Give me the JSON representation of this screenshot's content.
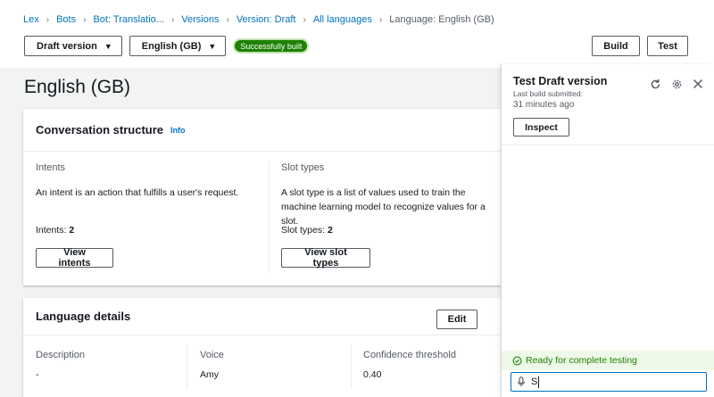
{
  "breadcrumb": {
    "items": [
      "Lex",
      "Bots",
      "Bot: Translatio...",
      "Versions",
      "Version: Draft",
      "All languages"
    ],
    "current": "Language: English (GB)"
  },
  "toolbar": {
    "version_dropdown": "Draft version",
    "language_dropdown": "English (GB)",
    "status_badge": "Successfully built",
    "build_label": "Build",
    "test_label": "Test"
  },
  "page_title": "English (GB)",
  "conversation": {
    "title": "Conversation structure",
    "info": "Info",
    "intents": {
      "label": "Intents",
      "description": "An intent is an action that fulfills a user's request.",
      "count_label": "Intents:",
      "count": "2",
      "button": "View intents"
    },
    "slot_types": {
      "label": "Slot types",
      "description": "A slot type is a list of values used to train the machine learning model to recognize values for a slot.",
      "count_label": "Slot types:",
      "count": "2",
      "button": "View slot types"
    }
  },
  "language_details": {
    "title": "Language details",
    "edit_label": "Edit",
    "description": {
      "label": "Description",
      "value": "-"
    },
    "voice": {
      "label": "Voice",
      "value": "Amy"
    },
    "confidence": {
      "label": "Confidence threshold",
      "value": "0.40"
    }
  },
  "test_panel": {
    "title": "Test Draft version",
    "subtitle": "Last build submitted:",
    "time": "31 minutes ago",
    "inspect_label": "Inspect",
    "ready_text": "Ready for complete testing",
    "input_value": "S",
    "icons": [
      "refresh-icon",
      "gear-icon",
      "close-icon",
      "check-circle-icon",
      "microphone-icon"
    ]
  },
  "colors": {
    "link": "#0073bb",
    "success": "#1d8102",
    "background": "#f2f3f3"
  }
}
